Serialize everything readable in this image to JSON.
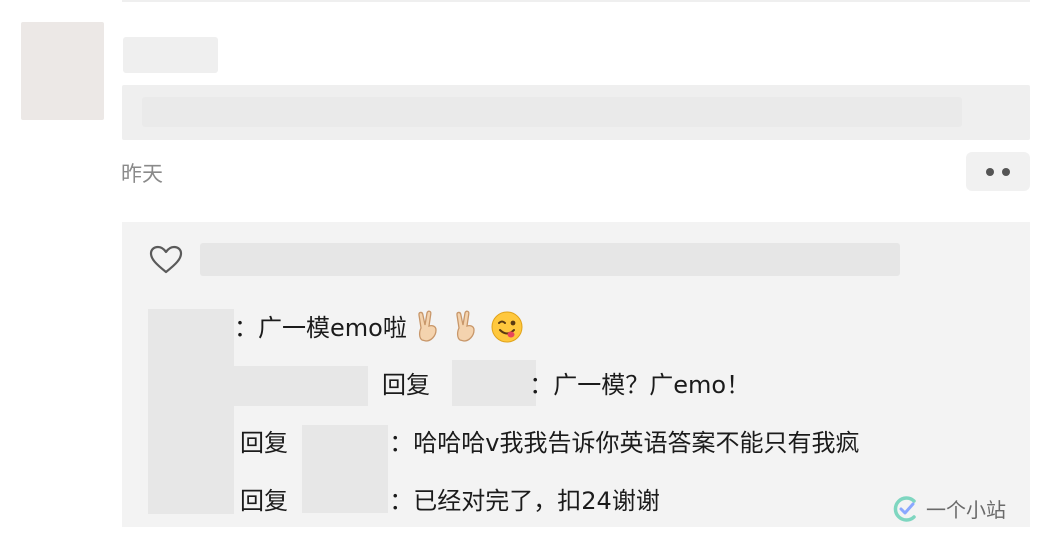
{
  "post": {
    "timestamp": "昨天"
  },
  "comments": [
    {
      "text": "：广一模emo啦"
    },
    {
      "reply_label": "回复",
      "text": "：广一模？广emo！"
    },
    {
      "reply_label": "回复",
      "text": "：哈哈哈v我我告诉你英语答案不能只有我疯"
    },
    {
      "reply_label": "回复",
      "text": "：已经对完了，扣24谢谢"
    }
  ],
  "watermark": {
    "text": "一个小站"
  }
}
